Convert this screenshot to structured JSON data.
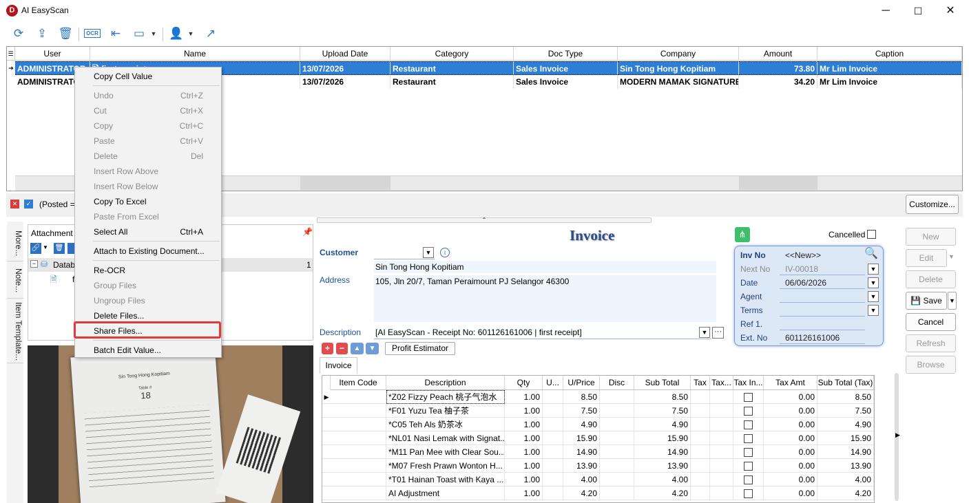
{
  "app": {
    "title": "AI EasyScan",
    "icon_letter": "D"
  },
  "window": {
    "minimize": "─",
    "maximize": "☐",
    "close": "✕"
  },
  "toolbar": {
    "ocr_label": "OCR"
  },
  "grid": {
    "columns": [
      "User",
      "Name",
      "Upload Date",
      "Category",
      "Doc Type",
      "Company",
      "Amount",
      "Caption"
    ],
    "rows": [
      {
        "user": "ADMINISTRATOR",
        "name": "first receipt",
        "date": "13/07/2026",
        "category": "Restaurant",
        "doctype": "Sales Invoice",
        "company": "Sin Tong Hong Kopitiam",
        "amount": "73.80",
        "caption": "Mr Lim Invoice"
      },
      {
        "user": "ADMINISTRATOR",
        "name": "",
        "date": "13/07/2026",
        "category": "Restaurant",
        "doctype": "Sales Invoice",
        "company": "MODERN MAMAK SIGNATURE",
        "amount": "34.20",
        "caption": "Mr Lim Invoice"
      }
    ]
  },
  "filter": {
    "text": "(Posted = ",
    "customize": "Customize..."
  },
  "left_tabs": [
    "More...",
    "Note...",
    "Item Template..."
  ],
  "attachments": {
    "title": "Attachment",
    "tree_root": "Datab",
    "tree_count": "1",
    "tree_child": "f"
  },
  "receipt": {
    "shop": "Sin Tong Hong Kopitiam",
    "table_label": "Table #",
    "table_no": "18"
  },
  "context_menu": [
    {
      "label": "Copy Cell Value",
      "shortcut": "",
      "disabled": false
    },
    {
      "sep": true
    },
    {
      "label": "Undo",
      "shortcut": "Ctrl+Z",
      "disabled": true
    },
    {
      "label": "Cut",
      "shortcut": "Ctrl+X",
      "disabled": true
    },
    {
      "label": "Copy",
      "shortcut": "Ctrl+C",
      "disabled": true
    },
    {
      "label": "Paste",
      "shortcut": "Ctrl+V",
      "disabled": true
    },
    {
      "label": "Delete",
      "shortcut": "Del",
      "disabled": true
    },
    {
      "label": "Insert Row Above",
      "shortcut": "",
      "disabled": true
    },
    {
      "label": "Insert Row Below",
      "shortcut": "",
      "disabled": true
    },
    {
      "label": "Copy To Excel",
      "shortcut": "",
      "disabled": false
    },
    {
      "label": "Paste From Excel",
      "shortcut": "",
      "disabled": true
    },
    {
      "label": "Select All",
      "shortcut": "Ctrl+A",
      "disabled": false
    },
    {
      "sep": true
    },
    {
      "label": "Attach to Existing Document...",
      "shortcut": "",
      "disabled": false
    },
    {
      "sep": true
    },
    {
      "label": "Re-OCR",
      "shortcut": "",
      "disabled": false
    },
    {
      "label": "Group Files",
      "shortcut": "",
      "disabled": true
    },
    {
      "label": "Ungroup Files",
      "shortcut": "",
      "disabled": true
    },
    {
      "label": "Delete Files...",
      "shortcut": "",
      "disabled": false
    },
    {
      "label": "Share Files...",
      "shortcut": "",
      "disabled": false
    },
    {
      "sep": true
    },
    {
      "label": "Batch Edit Value...",
      "shortcut": "",
      "disabled": false
    }
  ],
  "invoice": {
    "title": "Invoice",
    "cancelled_label": "Cancelled",
    "customer_label": "Customer",
    "customer_name": "Sin Tong Hong Kopitiam",
    "address_label": "Address",
    "address": "105, Jln 20/7, Taman Peraimount PJ Selangor 46300",
    "description_label": "Description",
    "description": "[AI EasyScan - Receipt No: 601126161006 | first receipt]",
    "profit_estimator": "Profit Estimator",
    "tab": "Invoice",
    "info": {
      "inv_no_label": "Inv No",
      "inv_no": "<<New>>",
      "next_no_label": "Next No",
      "next_no": "IV-00018",
      "date_label": "Date",
      "date": "06/06/2026",
      "agent_label": "Agent",
      "agent": "",
      "terms_label": "Terms",
      "terms": "",
      "ref_label": "Ref 1.",
      "ref": "",
      "ext_label": "Ext. No",
      "ext": "601126161006"
    }
  },
  "buttons": {
    "new": "New",
    "edit": "Edit",
    "delete": "Delete",
    "save": "Save",
    "cancel": "Cancel",
    "refresh": "Refresh",
    "browse": "Browse"
  },
  "detail": {
    "columns": [
      "Item Code",
      "Description",
      "Qty",
      "U...",
      "U/Price",
      "Disc",
      "Sub Total",
      "Tax",
      "Tax...",
      "Tax In...",
      "Tax Amt",
      "Sub Total (Tax)"
    ],
    "rows": [
      {
        "desc": "*Z02 Fizzy Peach 桃子气泡水",
        "qty": "1.00",
        "price": "8.50",
        "sub": "8.50",
        "taxamt": "0.00",
        "subtax": "8.50"
      },
      {
        "desc": "*F01 Yuzu Tea 柚子茶",
        "qty": "1.00",
        "price": "7.50",
        "sub": "7.50",
        "taxamt": "0.00",
        "subtax": "7.50"
      },
      {
        "desc": "*C05 Teh Als 奶茶冰",
        "qty": "1.00",
        "price": "4.90",
        "sub": "4.90",
        "taxamt": "0.00",
        "subtax": "4.90"
      },
      {
        "desc": "*NL01 Nasi Lemak with Signat...",
        "qty": "1.00",
        "price": "15.90",
        "sub": "15.90",
        "taxamt": "0.00",
        "subtax": "15.90"
      },
      {
        "desc": "*M11 Pan Mee with Clear Sou...",
        "qty": "1.00",
        "price": "14.90",
        "sub": "14.90",
        "taxamt": "0.00",
        "subtax": "14.90"
      },
      {
        "desc": "*M07 Fresh Prawn Wonton H...",
        "qty": "1.00",
        "price": "13.90",
        "sub": "13.90",
        "taxamt": "0.00",
        "subtax": "13.90"
      },
      {
        "desc": "*T01 Hainan Toast with Kaya ...",
        "qty": "1.00",
        "price": "4.00",
        "sub": "4.00",
        "taxamt": "0.00",
        "subtax": "4.00"
      },
      {
        "desc": "AI Adjustment",
        "qty": "1.00",
        "price": "4.20",
        "sub": "4.20",
        "taxamt": "0.00",
        "subtax": "4.20"
      }
    ]
  }
}
